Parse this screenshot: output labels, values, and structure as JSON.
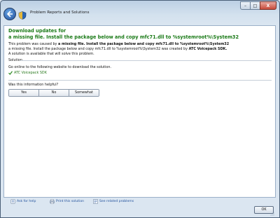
{
  "window": {
    "title": "Problem Reports and Solutions",
    "minimize_glyph": "–",
    "maximize_glyph": "□",
    "close_glyph": "X"
  },
  "content": {
    "heading_line1": "Download updates for",
    "heading_line2": "a missing file. Install the package below and copy mfc71.dll to %systemroot%\\System32",
    "desc_prefix": "This problem was caused by ",
    "desc_bold": "a missing file. Install the package below and copy mfc71.dll to %systemroot%\\System32",
    "desc_mid": "a missing file. Install the package below and copy mfc71.dll to %systemroot%\\System32 was created by ",
    "desc_creator": "ATC Voicepack SDK.",
    "available": "A solution is available that will solve this problem.",
    "section_label": "Solution",
    "online_text": "Go online to the following website to download the solution.",
    "solution_link": "ATC Voicepack SDK",
    "helpful_question": "Was this information helpful?",
    "choices": [
      "Yes",
      "No",
      "Somewhat"
    ]
  },
  "footer": {
    "ask_for_help": "Ask for help",
    "print_solution": "Print this solution",
    "see_related": "See related problems",
    "ok_label": "OK"
  },
  "colors": {
    "heading_green": "#1a7a17",
    "link_blue": "#1f4f9b"
  }
}
